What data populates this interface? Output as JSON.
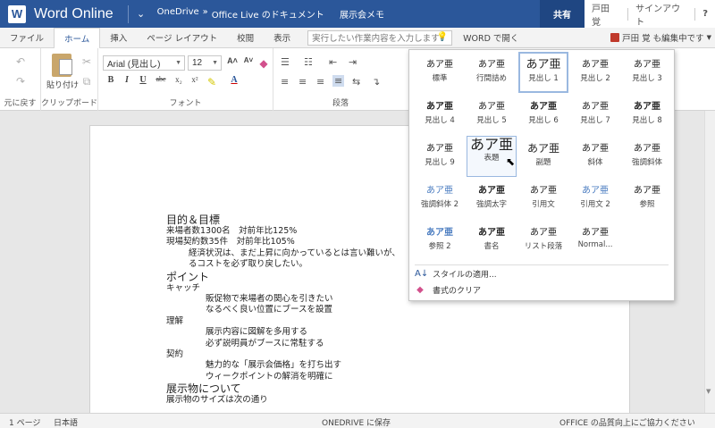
{
  "titlebar": {
    "app_name": "Word Online",
    "logo_letter": "W",
    "breadcrumb_1": "OneDrive",
    "breadcrumb_sep": "»",
    "breadcrumb_2": "Office Live のドキュメント",
    "doc_title": "展示会メモ",
    "share": "共有",
    "user_name": "戸田 覚",
    "signout": "サインアウト",
    "help": "?"
  },
  "tabs": {
    "file": "ファイル",
    "home": "ホーム",
    "insert": "挿入",
    "page_layout": "ページ レイアウト",
    "review": "校閲",
    "view": "表示",
    "tellme_placeholder": "実行したい作業内容を入力します",
    "open_in_word": "WORD で開く",
    "editing_status": "戸田 覚 も編集中です"
  },
  "ribbon": {
    "undo_label": "元に戻す",
    "clipboard_label": "クリップボード",
    "paste_label": "貼り付け",
    "font_name": "Arial (見出し)",
    "font_size": "12",
    "font_label": "フォント",
    "paragraph_label": "段落",
    "bold": "B",
    "italic": "I",
    "underline": "U",
    "strike": "abc",
    "subscript": "x₂",
    "superscript": "x²",
    "font_color": "A",
    "grow": "A˄",
    "shrink": "A˅"
  },
  "document": {
    "lines": [
      {
        "text": "目的＆目標",
        "style": "h"
      },
      {
        "text": "来場者数1300名　対前年比125%",
        "style": ""
      },
      {
        "text": "現場契約数35件　対前年比105%",
        "style": ""
      },
      {
        "text": "経済状況は、まだ上昇に向かっているとは言い難いが、",
        "style": "in1"
      },
      {
        "text": "るコストを必ず取り戻したい。",
        "style": "in1"
      },
      {
        "text": "ポイント",
        "style": "h"
      },
      {
        "text": "キャッチ",
        "style": ""
      },
      {
        "text": "販促物で来場者の関心を引きたい",
        "style": "in2"
      },
      {
        "text": "なるべく良い位置にブースを設置",
        "style": "in2"
      },
      {
        "text": "理解",
        "style": ""
      },
      {
        "text": "展示内容に図解を多用する",
        "style": "in2"
      },
      {
        "text": "必ず説明員がブースに常駐する",
        "style": "in2"
      },
      {
        "text": "契約",
        "style": ""
      },
      {
        "text": "魅力的な「展示会価格」を打ち出す",
        "style": "in2"
      },
      {
        "text": "ウィークポイントの解消を明確に",
        "style": "in2"
      },
      {
        "text": "展示物について",
        "style": "h"
      },
      {
        "text": "展示物のサイズは次の通り",
        "style": ""
      }
    ]
  },
  "gallery": {
    "sample": "あア亜",
    "styles": [
      {
        "name": "標準"
      },
      {
        "name": "行間詰め"
      },
      {
        "name": "見出し 1"
      },
      {
        "name": "見出し 2"
      },
      {
        "name": "見出し 3"
      },
      {
        "name": "見出し 4"
      },
      {
        "name": "見出し 5"
      },
      {
        "name": "見出し 6"
      },
      {
        "name": "見出し 7"
      },
      {
        "name": "見出し 8"
      },
      {
        "name": "見出し 9"
      },
      {
        "name": "表題"
      },
      {
        "name": "副題"
      },
      {
        "name": "斜体"
      },
      {
        "name": "強調斜体"
      },
      {
        "name": "強調斜体 2"
      },
      {
        "name": "強調太字"
      },
      {
        "name": "引用文"
      },
      {
        "name": "引用文 2"
      },
      {
        "name": "参照"
      },
      {
        "name": "参照 2"
      },
      {
        "name": "書名"
      },
      {
        "name": "リスト段落"
      },
      {
        "name": "Normal..."
      }
    ],
    "apply_styles": "スタイルの適用...",
    "clear_formatting": "書式のクリア"
  },
  "statusbar": {
    "page": "1 ページ",
    "language": "日本語",
    "saved": "ONEDRIVE に保存",
    "feedback": "OFFICE の品質向上にご協力ください"
  },
  "colors": {
    "brand": "#2b579a",
    "share_bg": "#1f4682",
    "editing_badge": "#c0392b"
  }
}
